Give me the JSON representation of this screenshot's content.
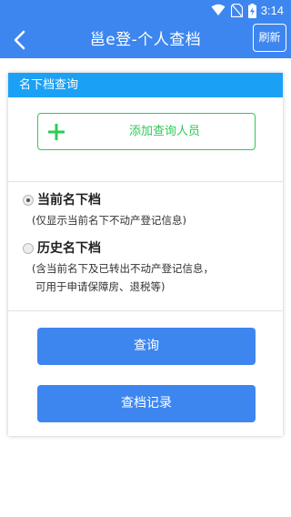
{
  "status": {
    "time": "3:14"
  },
  "appbar": {
    "title": "邕e登-个人查档",
    "refresh_label": "刷新"
  },
  "card": {
    "header": "名下档查询",
    "add_label": "添加查询人员",
    "options": [
      {
        "title": "当前名下档",
        "desc": [
          "(仅显示当前名下不动产登记信息)"
        ],
        "checked": true
      },
      {
        "title": "历史名下档",
        "desc": [
          "(含当前名下及已转出不动产登记信息，",
          "可用于申请保障房、退税等)"
        ],
        "checked": false
      }
    ],
    "query_label": "查询",
    "records_label": "查档记录"
  },
  "colors": {
    "primary": "#3d86f0",
    "header": "#1aa1f5",
    "add_green": "#2dcb56"
  },
  "icons": {
    "back": "chevron-left-icon",
    "add": "plus-icon",
    "wifi": "wifi-icon",
    "sim": "no-sim-icon",
    "battery": "battery-charging-icon"
  }
}
